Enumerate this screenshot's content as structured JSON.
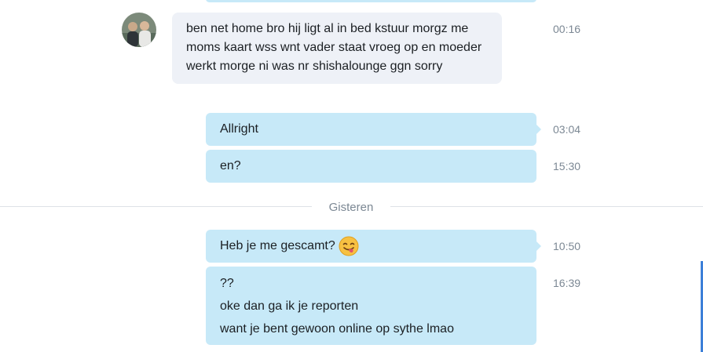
{
  "messages": [
    {
      "text": "ben net home bro hij ligt al in bed kstuur morgz me moms kaart wss wnt vader staat vroeg op en moeder werkt morge ni was nr shishalounge ggn sorry",
      "time": "00:16"
    },
    {
      "text": "Allright",
      "time": "03:04"
    },
    {
      "text": "en?",
      "time": "15:30"
    },
    {
      "text": "Heb je me gescamt?",
      "time": "10:50",
      "emoji": "tongue-out-emoji"
    },
    {
      "lines": [
        "??",
        "oke dan ga ik je reporten",
        "want je bent gewoon online op sythe lmao"
      ],
      "time": "16:39"
    }
  ],
  "date_divider": "Gisteren",
  "colors": {
    "incoming_bubble": "#eef1f7",
    "outgoing_bubble": "#c7e9f8",
    "timestamp": "#7c8894"
  }
}
